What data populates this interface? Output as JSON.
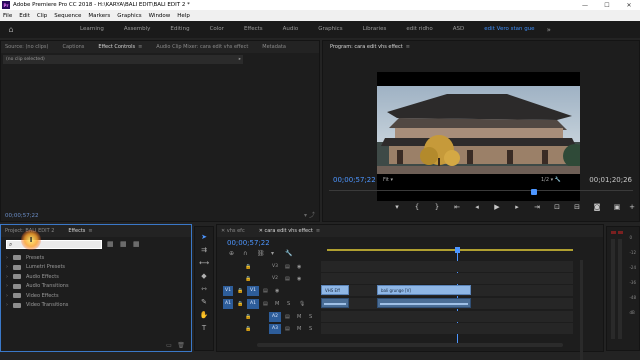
{
  "window": {
    "app_icon": "Pr",
    "title": "Adobe Premiere Pro CC 2018 - H:\\KARYA\\BALI EDIT\\BALI EDIT 2 *",
    "controls": [
      "—",
      "☐",
      "✕"
    ]
  },
  "menu": [
    "File",
    "Edit",
    "Clip",
    "Sequence",
    "Markers",
    "Graphics",
    "Window",
    "Help"
  ],
  "workspaces": {
    "tabs": [
      "Learning",
      "Assembly",
      "Editing",
      "Color",
      "Effects",
      "Audio",
      "Graphics",
      "Libraries",
      "edit ridho",
      "ASD",
      "edit Vero stan gue"
    ],
    "active": "edit Vero stan gue",
    "more": "»"
  },
  "source_panel": {
    "tabs": [
      "Source: (no clips)",
      "Captions",
      "Effect Controls",
      "Audio Clip Mixer: cara edit vhs effect",
      "Metadata"
    ],
    "active_tab": "Effect Controls",
    "menu_icon": "≡",
    "header": "(no clip selected)",
    "timecode": "00;00;57;22"
  },
  "program_panel": {
    "title": "Program: cara edit vhs effect",
    "timecode": "00;00;57;22",
    "fit": "Fit",
    "resolution": "1/2",
    "duration": "00;01;20;26"
  },
  "project_panel": {
    "tabs": [
      "Project: BALI EDIT 2",
      "Effects"
    ],
    "active_tab": "Effects",
    "search_placeholder": "",
    "effects": [
      "Presets",
      "Lumetri Presets",
      "Audio Effects",
      "Audio Transitions",
      "Video Effects",
      "Video Transitions"
    ]
  },
  "timeline": {
    "tabs": [
      "vhs efc",
      "cara edit vhs effect"
    ],
    "active_tab": "cara edit vhs effect",
    "timecode": "00;00;57;22",
    "video_tracks": [
      {
        "name": "V3",
        "source": ""
      },
      {
        "name": "V2",
        "source": ""
      },
      {
        "name": "V1",
        "source": "V1"
      }
    ],
    "audio_tracks": [
      {
        "name": "A1",
        "source": "A1"
      },
      {
        "name": "A2",
        "source": ""
      },
      {
        "name": "A3",
        "source": ""
      }
    ],
    "clips": {
      "v1_a": "VHS Eff",
      "v1_b": "bali grunge [V]"
    },
    "mute_label": "M",
    "solo_label": "S"
  },
  "audio_meter": {
    "scale": [
      "0",
      "-12",
      "-24",
      "-36",
      "-48",
      "dB"
    ],
    "footer": "S S"
  }
}
